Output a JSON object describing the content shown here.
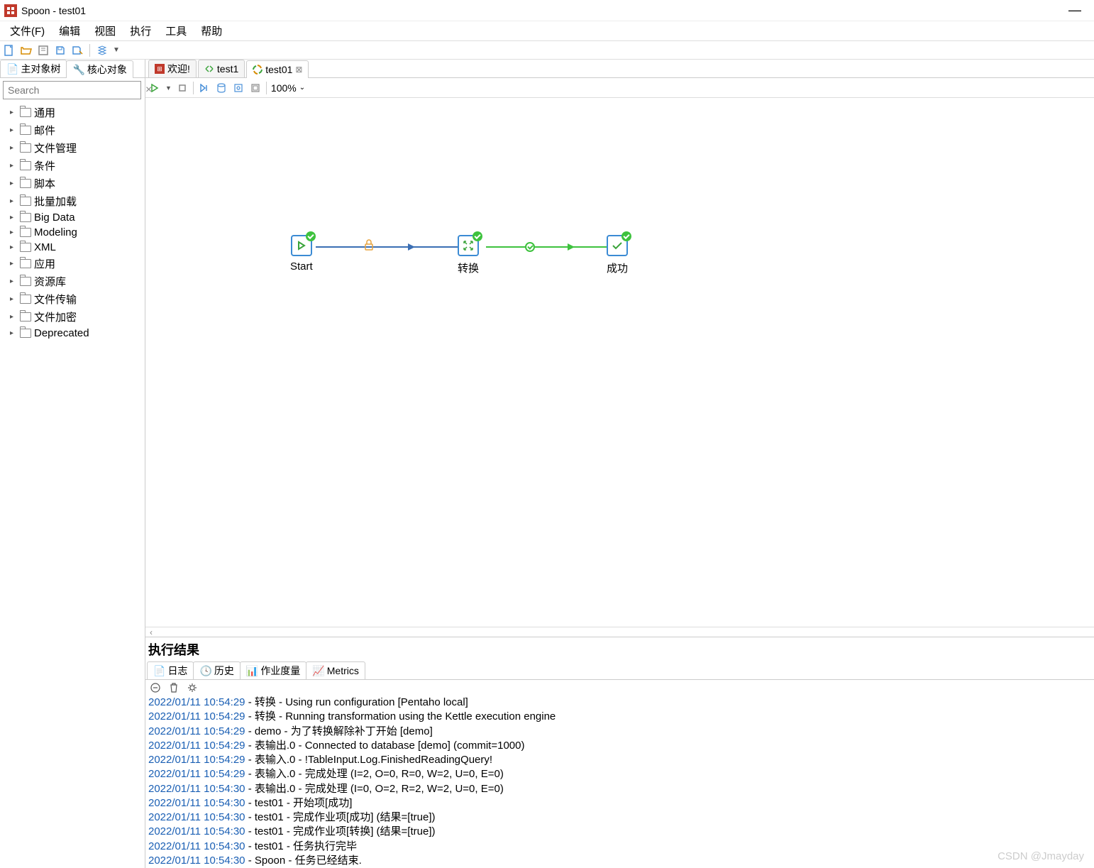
{
  "title": "Spoon - test01",
  "menu": [
    "文件(F)",
    "编辑",
    "视图",
    "执行",
    "工具",
    "帮助"
  ],
  "sidebar_tabs": [
    {
      "label": "主对象树",
      "icon": "tree"
    },
    {
      "label": "核心对象",
      "icon": "puzzle"
    }
  ],
  "search_placeholder": "Search",
  "tree_items": [
    "通用",
    "邮件",
    "文件管理",
    "条件",
    "脚本",
    "批量加载",
    "Big Data",
    "Modeling",
    "XML",
    "应用",
    "资源库",
    "文件传输",
    "文件加密",
    "Deprecated"
  ],
  "editor_tabs": [
    {
      "label": "欢迎!",
      "active": false,
      "type": "welcome"
    },
    {
      "label": "test1",
      "active": false,
      "type": "trans"
    },
    {
      "label": "test01",
      "active": true,
      "type": "job"
    }
  ],
  "zoom": "100%",
  "nodes": {
    "start": {
      "label": "Start"
    },
    "transform": {
      "label": "转换"
    },
    "success": {
      "label": "成功"
    }
  },
  "results_title": "执行结果",
  "results_tabs": [
    "日志",
    "历史",
    "作业度量",
    "Metrics"
  ],
  "log_lines": [
    {
      "ts": "2022/01/11 10:54:29",
      "msg": " - 转换 - Using run configuration [Pentaho local]"
    },
    {
      "ts": "2022/01/11 10:54:29",
      "msg": " - 转换 - Running transformation using the Kettle execution engine"
    },
    {
      "ts": "2022/01/11 10:54:29",
      "msg": " - demo - 为了转换解除补丁开始  [demo]"
    },
    {
      "ts": "2022/01/11 10:54:29",
      "msg": " - 表输出.0 - Connected to database [demo] (commit=1000)"
    },
    {
      "ts": "2022/01/11 10:54:29",
      "msg": " - 表输入.0 - !TableInput.Log.FinishedReadingQuery!"
    },
    {
      "ts": "2022/01/11 10:54:29",
      "msg": " - 表输入.0 - 完成处理 (I=2, O=0, R=0, W=2, U=0, E=0)"
    },
    {
      "ts": "2022/01/11 10:54:30",
      "msg": " - 表输出.0 - 完成处理 (I=0, O=2, R=2, W=2, U=0, E=0)"
    },
    {
      "ts": "2022/01/11 10:54:30",
      "msg": " - test01 - 开始项[成功]"
    },
    {
      "ts": "2022/01/11 10:54:30",
      "msg": " - test01 - 完成作业项[成功] (结果=[true])"
    },
    {
      "ts": "2022/01/11 10:54:30",
      "msg": " - test01 - 完成作业项[转换] (结果=[true])"
    },
    {
      "ts": "2022/01/11 10:54:30",
      "msg": " - test01 - 任务执行完毕"
    },
    {
      "ts": "2022/01/11 10:54:30",
      "msg": " - Spoon - 任务已经结束."
    }
  ],
  "watermark": "CSDN @Jmayday"
}
